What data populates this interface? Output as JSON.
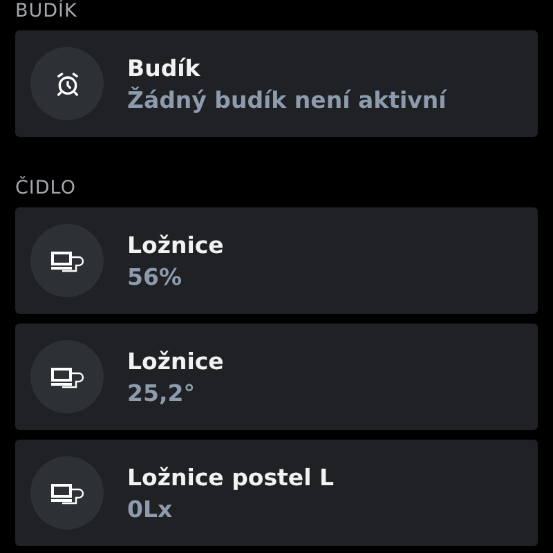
{
  "sections": [
    {
      "title": "BUDÍK",
      "items": [
        {
          "kind": "alarm",
          "name": "Budík",
          "value": "Žádný budík není aktivní"
        }
      ]
    },
    {
      "title": "ČIDLO",
      "items": [
        {
          "kind": "sensor",
          "name": "Ložnice",
          "value": "56%"
        },
        {
          "kind": "sensor",
          "name": "Ložnice",
          "value": "25,2°"
        },
        {
          "kind": "sensor",
          "name": "Ložnice postel L",
          "value": "0Lx"
        }
      ]
    }
  ]
}
